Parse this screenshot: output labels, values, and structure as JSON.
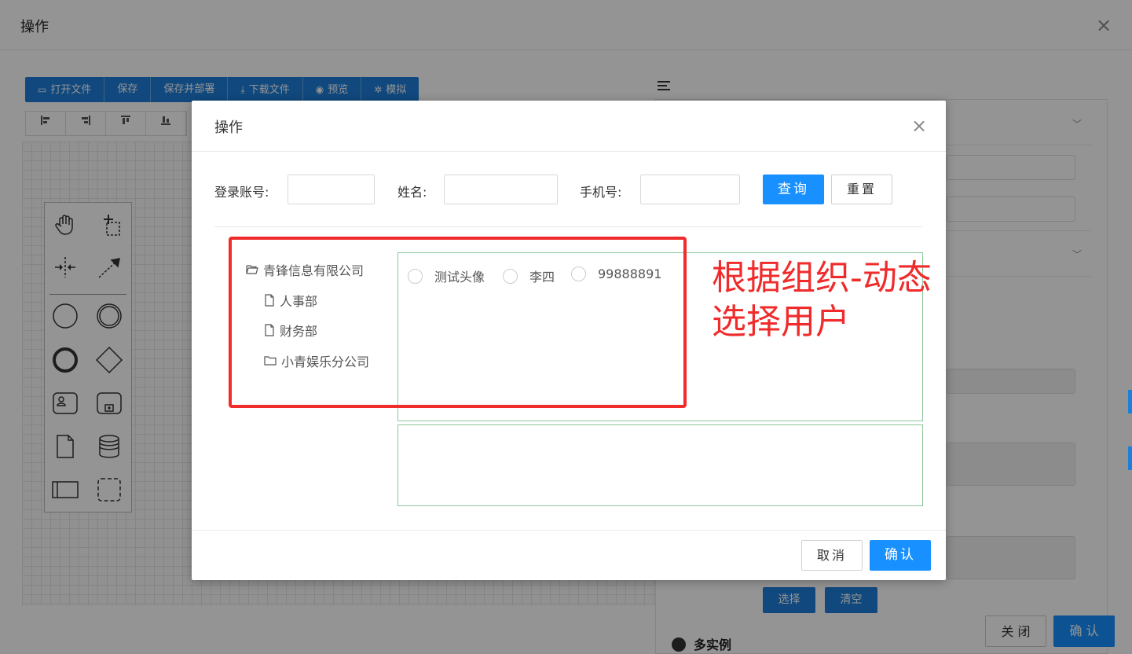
{
  "outer": {
    "title": "操作",
    "close": "×",
    "toolbar": [
      {
        "icon": "folder-open-icon",
        "glyph": "▭",
        "label": "打开文件"
      },
      {
        "icon": "",
        "glyph": "",
        "label": "保存"
      },
      {
        "icon": "",
        "glyph": "",
        "label": "保存并部署"
      },
      {
        "icon": "download-icon",
        "glyph": "⤓",
        "label": "下载文件"
      },
      {
        "icon": "eye-icon",
        "glyph": "◉",
        "label": "预览"
      },
      {
        "icon": "gear-icon",
        "glyph": "✲",
        "label": "模拟"
      }
    ],
    "align_buttons": [
      "align-left-icon",
      "align-right-icon",
      "align-top-icon",
      "align-bottom-icon"
    ],
    "panel": {
      "select_label": "选择",
      "clear_label": "清空",
      "multi_instance_label": "多实例",
      "close_label": "关 闭",
      "confirm_label": "确 认"
    }
  },
  "modal": {
    "title": "操作",
    "close": "×",
    "search": {
      "account_label": "登录账号:",
      "name_label": "姓名:",
      "phone_label": "手机号:",
      "account_value": "",
      "name_value": "",
      "phone_value": "",
      "query_label": "查询",
      "reset_label": "重置"
    },
    "tree": [
      {
        "label": "青锋信息有限公司",
        "icon": "folder-open-icon",
        "level": 0
      },
      {
        "label": "人事部",
        "icon": "file-icon",
        "level": 1
      },
      {
        "label": "财务部",
        "icon": "file-icon",
        "level": 1
      },
      {
        "label": "小青娱乐分公司",
        "icon": "folder-icon",
        "level": 1
      }
    ],
    "users": [
      "测试头像",
      "李四",
      "99888891"
    ],
    "selected_users": [],
    "cancel_label": "取消",
    "ok_label": "确认"
  },
  "annotation": {
    "line1": "根据组织-动态",
    "line2": "选择用户",
    "color": "#f02b2b"
  },
  "colors": {
    "primary": "#1890ff",
    "toolbar": "#1e7fd9",
    "box_border": "#8bc79a"
  }
}
